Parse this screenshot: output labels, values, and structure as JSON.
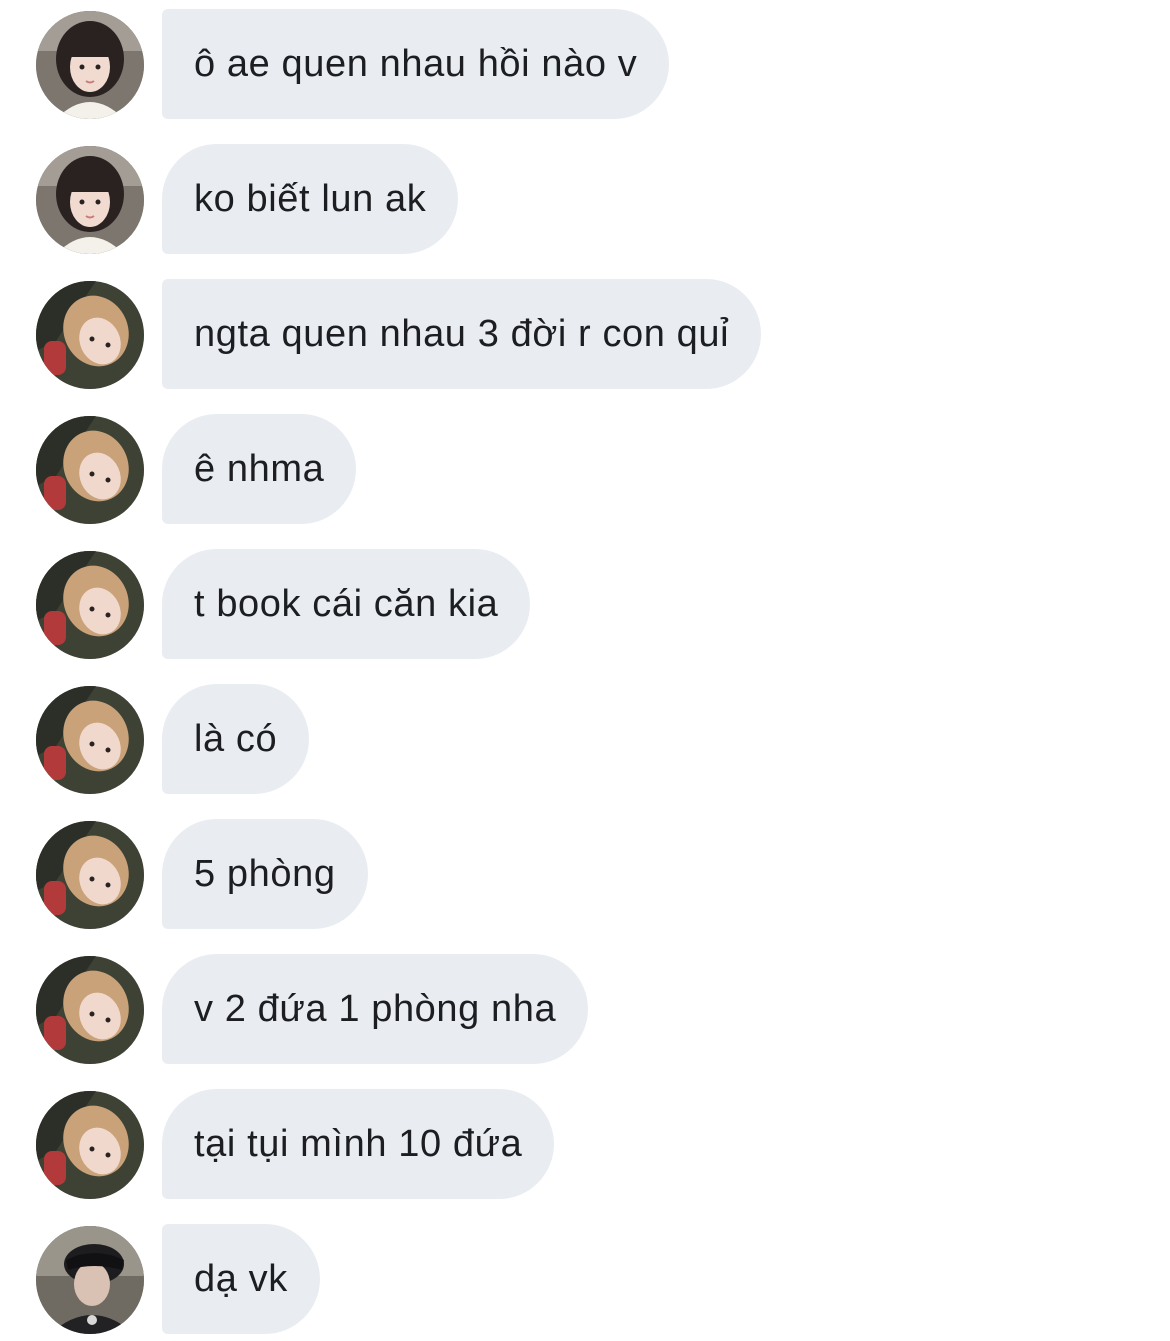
{
  "messages": [
    {
      "text": "ô ae quen nhau hồi nào v",
      "avatar": "avatar-girl-bangs"
    },
    {
      "text": "ko biết lun ak",
      "avatar": "avatar-girl-bangs"
    },
    {
      "text": "ngta quen nhau 3 đời r con quỉ",
      "avatar": "avatar-girl-blonde"
    },
    {
      "text": "ê nhma",
      "avatar": "avatar-girl-blonde"
    },
    {
      "text": "t book cái căn kia",
      "avatar": "avatar-girl-blonde"
    },
    {
      "text": "là có",
      "avatar": "avatar-girl-blonde"
    },
    {
      "text": "5 phòng",
      "avatar": "avatar-girl-blonde"
    },
    {
      "text": "v 2 đứa 1 phòng nha",
      "avatar": "avatar-girl-blonde"
    },
    {
      "text": "tại tụi mình 10 đứa",
      "avatar": "avatar-girl-blonde"
    },
    {
      "text": "dạ vk",
      "avatar": "avatar-boy-cap"
    }
  ],
  "colors": {
    "bubble": "#e9ecf1",
    "text": "#1c1e21",
    "background": "#ffffff"
  }
}
